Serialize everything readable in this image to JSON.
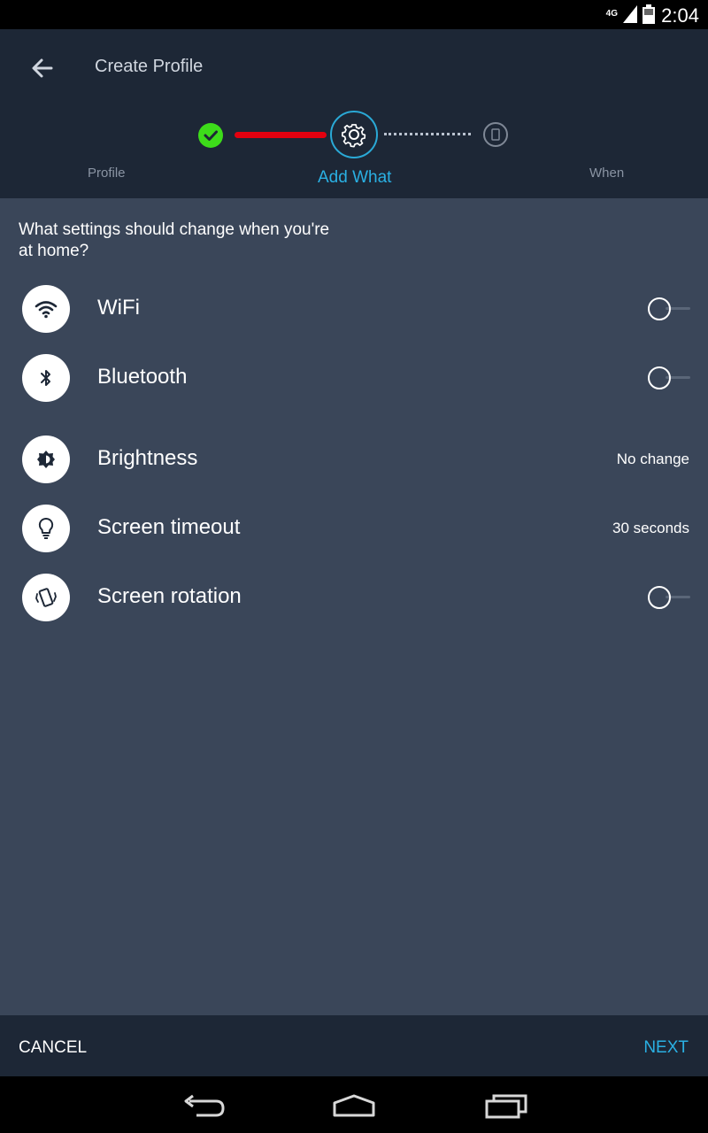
{
  "status_bar": {
    "network": "4G",
    "time": "2:04"
  },
  "header": {
    "title": "Create Profile",
    "back_icon": "arrow-left-icon"
  },
  "stepper": {
    "steps": [
      {
        "label": "Profile",
        "state": "done",
        "icon": "check-icon"
      },
      {
        "label": "Add What",
        "state": "current",
        "icon": "gear-icon"
      },
      {
        "label": "When",
        "state": "pending",
        "icon": "phone-icon"
      }
    ],
    "colors": {
      "done": "#3ddc1a",
      "progress_line": "#e3000f",
      "accent": "#2ab0e3"
    }
  },
  "question": "What settings should change when you're at home?",
  "settings": [
    {
      "label": "WiFi",
      "icon": "wifi-icon",
      "control": "toggle",
      "on": false
    },
    {
      "label": "Bluetooth",
      "icon": "bluetooth-icon",
      "control": "toggle",
      "on": false
    },
    {
      "label": "Brightness",
      "icon": "brightness-icon",
      "control": "value",
      "value": "No change"
    },
    {
      "label": "Screen timeout",
      "icon": "lightbulb-icon",
      "control": "value",
      "value": "30 seconds"
    },
    {
      "label": "Screen rotation",
      "icon": "rotation-icon",
      "control": "toggle",
      "on": false
    }
  ],
  "actions": {
    "cancel": "CANCEL",
    "next": "NEXT"
  },
  "nav": [
    "back-icon",
    "home-icon",
    "recents-icon"
  ]
}
